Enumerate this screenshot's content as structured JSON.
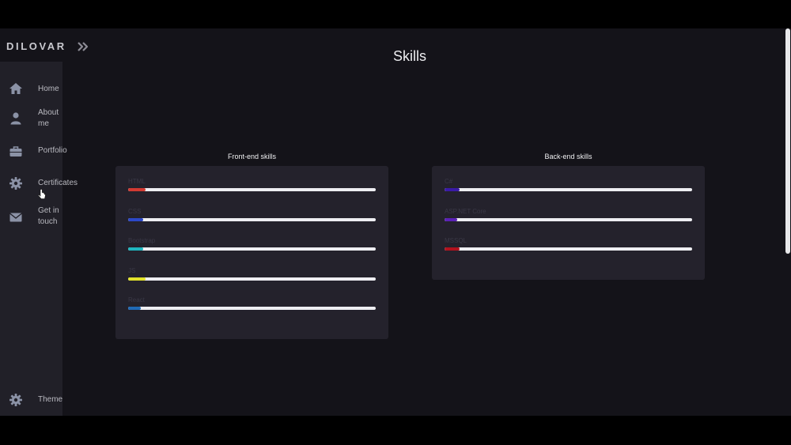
{
  "brand": {
    "name": "DILOVAR",
    "toggle_icon": "double-chevron-right-icon"
  },
  "sidebar": {
    "items": [
      {
        "label": "Home",
        "icon": "home-icon"
      },
      {
        "label": "About me",
        "icon": "user-icon"
      },
      {
        "label": "Portfolio",
        "icon": "briefcase-icon"
      },
      {
        "label": "Certificates",
        "icon": "gear-icon"
      },
      {
        "label": "Get in touch",
        "icon": "mail-icon"
      }
    ],
    "theme": {
      "label": "Theme",
      "icon": "gear-icon"
    }
  },
  "page": {
    "title": "Skills"
  },
  "frontend": {
    "title": "Front-end skills",
    "skills": [
      {
        "name": "HTML",
        "level": 0.07,
        "color": "#d23a32"
      },
      {
        "name": "CSS",
        "level": 0.06,
        "color": "#2c48c8"
      },
      {
        "name": "Bootstrap",
        "level": 0.06,
        "color": "#1fb6bf"
      },
      {
        "name": "JS",
        "level": 0.07,
        "color": "#e2e22b"
      },
      {
        "name": "React",
        "level": 0.05,
        "color": "#1f6ab6"
      }
    ]
  },
  "backend": {
    "title": "Back-end skills",
    "skills": [
      {
        "name": "C#",
        "level": 0.06,
        "color": "#3a1aa6"
      },
      {
        "name": "ASP.NET Core",
        "level": 0.05,
        "color": "#5b21b6"
      },
      {
        "name": "MSSQL",
        "level": 0.06,
        "color": "#b2121e"
      }
    ]
  }
}
